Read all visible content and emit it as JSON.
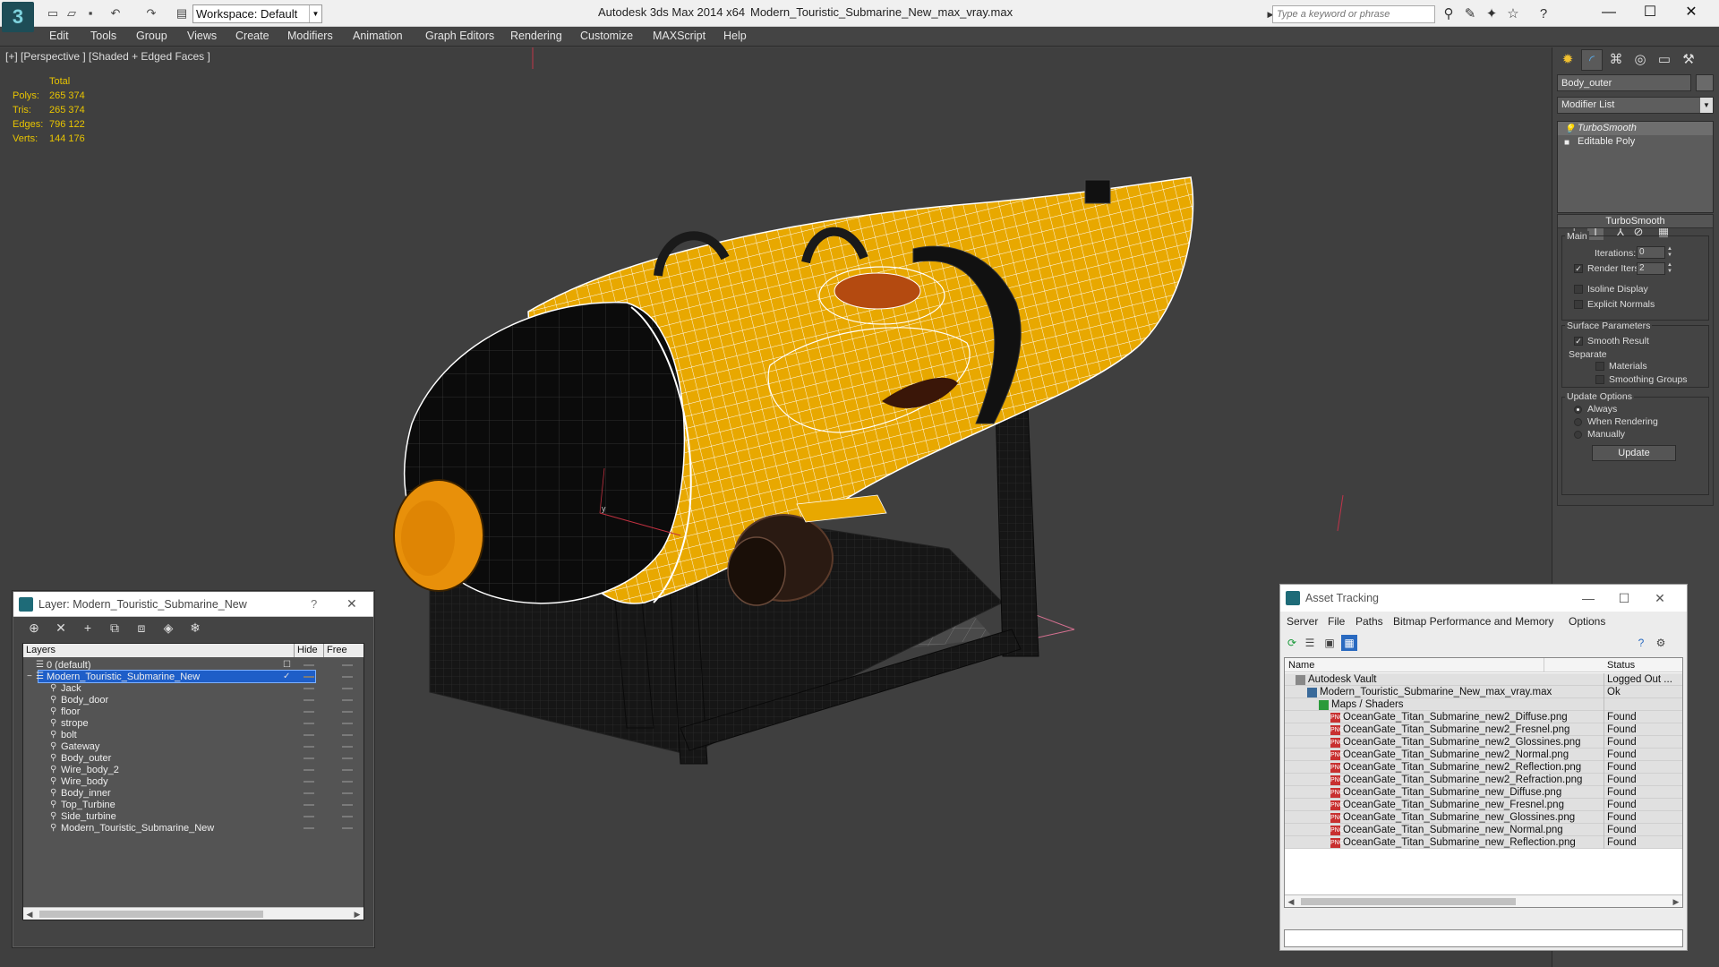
{
  "titlebar": {
    "app_title": "Autodesk 3ds Max  2014 x64",
    "file_title": "Modern_Touristic_Submarine_New_max_vray.max",
    "workspace_label": "Workspace: Default",
    "search_placeholder": "Type a keyword or phrase"
  },
  "menubar": {
    "items": [
      "Edit",
      "Tools",
      "Group",
      "Views",
      "Create",
      "Modifiers",
      "Animation",
      "Graph Editors",
      "Rendering",
      "Customize",
      "MAXScript",
      "Help"
    ]
  },
  "viewport": {
    "label": "[+] [Perspective ] [Shaded + Edged Faces ]",
    "stats": {
      "header": "Total",
      "rows": [
        {
          "key": "Polys:",
          "value": "265 374"
        },
        {
          "key": "Tris:",
          "value": "265 374"
        },
        {
          "key": "Edges:",
          "value": "796 122"
        },
        {
          "key": "Verts:",
          "value": "144 176"
        }
      ]
    },
    "axis_label": "y"
  },
  "command_panel": {
    "object_name": "Body_outer",
    "modifier_list": "Modifier List",
    "stack": [
      {
        "label": "TurboSmooth",
        "selected": true
      },
      {
        "label": "Editable Poly",
        "selected": false
      }
    ],
    "turbosmooth": {
      "title": "TurboSmooth",
      "main_label": "Main",
      "iterations_label": "Iterations:",
      "iterations_value": "0",
      "render_iters_label": "Render Iters:",
      "render_iters_value": "2",
      "render_iters_checked": "✓",
      "isoline_label": "Isoline Display",
      "explicit_normals_label": "Explicit Normals",
      "surface_params_label": "Surface Parameters",
      "smooth_result_label": "Smooth Result",
      "smooth_result_checked": "✓",
      "separate_label": "Separate",
      "materials_label": "Materials",
      "smoothing_groups_label": "Smoothing Groups",
      "update_options_label": "Update Options",
      "always_label": "Always",
      "when_rendering_label": "When Rendering",
      "manually_label": "Manually",
      "update_button": "Update"
    }
  },
  "layer_dialog": {
    "title": "Layer: Modern_Touristic_Submarine_New",
    "help": "?",
    "close": "✕",
    "columns": [
      "Layers",
      "Hide",
      "Free"
    ],
    "rows": [
      {
        "name": "0 (default)",
        "indent": 0,
        "mark": "☐"
      },
      {
        "name": "Modern_Touristic_Submarine_New",
        "indent": 0,
        "mark": "✓",
        "selected": true
      },
      {
        "name": "Jack",
        "indent": 1
      },
      {
        "name": "Body_door",
        "indent": 1
      },
      {
        "name": "floor",
        "indent": 1
      },
      {
        "name": "strope",
        "indent": 1
      },
      {
        "name": "bolt",
        "indent": 1
      },
      {
        "name": "Gateway",
        "indent": 1
      },
      {
        "name": "Body_outer",
        "indent": 1
      },
      {
        "name": "Wire_body_2",
        "indent": 1
      },
      {
        "name": "Wire_body",
        "indent": 1
      },
      {
        "name": "Body_inner",
        "indent": 1
      },
      {
        "name": "Top_Turbine",
        "indent": 1
      },
      {
        "name": "Side_turbine",
        "indent": 1
      },
      {
        "name": "Modern_Touristic_Submarine_New",
        "indent": 1
      }
    ]
  },
  "asset_dialog": {
    "title": "Asset Tracking",
    "menu": [
      "Server",
      "File",
      "Paths",
      "Bitmap Performance and Memory",
      "Options"
    ],
    "columns": [
      "Name",
      "Status"
    ],
    "rows": [
      {
        "name": "Autodesk Vault",
        "status": "Logged Out ...",
        "indent": 0,
        "icon": "vault"
      },
      {
        "name": "Modern_Touristic_Submarine_New_max_vray.max",
        "status": "Ok",
        "indent": 1,
        "icon": "max"
      },
      {
        "name": "Maps / Shaders",
        "status": "",
        "indent": 2,
        "icon": "maps"
      },
      {
        "name": "OceanGate_Titan_Submarine_new2_Diffuse.png",
        "status": "Found",
        "indent": 3,
        "icon": "png"
      },
      {
        "name": "OceanGate_Titan_Submarine_new2_Fresnel.png",
        "status": "Found",
        "indent": 3,
        "icon": "png"
      },
      {
        "name": "OceanGate_Titan_Submarine_new2_Glossines.png",
        "status": "Found",
        "indent": 3,
        "icon": "png"
      },
      {
        "name": "OceanGate_Titan_Submarine_new2_Normal.png",
        "status": "Found",
        "indent": 3,
        "icon": "png"
      },
      {
        "name": "OceanGate_Titan_Submarine_new2_Reflection.png",
        "status": "Found",
        "indent": 3,
        "icon": "png"
      },
      {
        "name": "OceanGate_Titan_Submarine_new2_Refraction.png",
        "status": "Found",
        "indent": 3,
        "icon": "png"
      },
      {
        "name": "OceanGate_Titan_Submarine_new_Diffuse.png",
        "status": "Found",
        "indent": 3,
        "icon": "png"
      },
      {
        "name": "OceanGate_Titan_Submarine_new_Fresnel.png",
        "status": "Found",
        "indent": 3,
        "icon": "png"
      },
      {
        "name": "OceanGate_Titan_Submarine_new_Glossines.png",
        "status": "Found",
        "indent": 3,
        "icon": "png"
      },
      {
        "name": "OceanGate_Titan_Submarine_new_Normal.png",
        "status": "Found",
        "indent": 3,
        "icon": "png"
      },
      {
        "name": "OceanGate_Titan_Submarine_new_Reflection.png",
        "status": "Found",
        "indent": 3,
        "icon": "png"
      }
    ]
  },
  "colors": {
    "hull": "#e8a800",
    "wire": "#ffffff",
    "stats_text": "#e8c400",
    "selection": "#1e5ec8"
  }
}
